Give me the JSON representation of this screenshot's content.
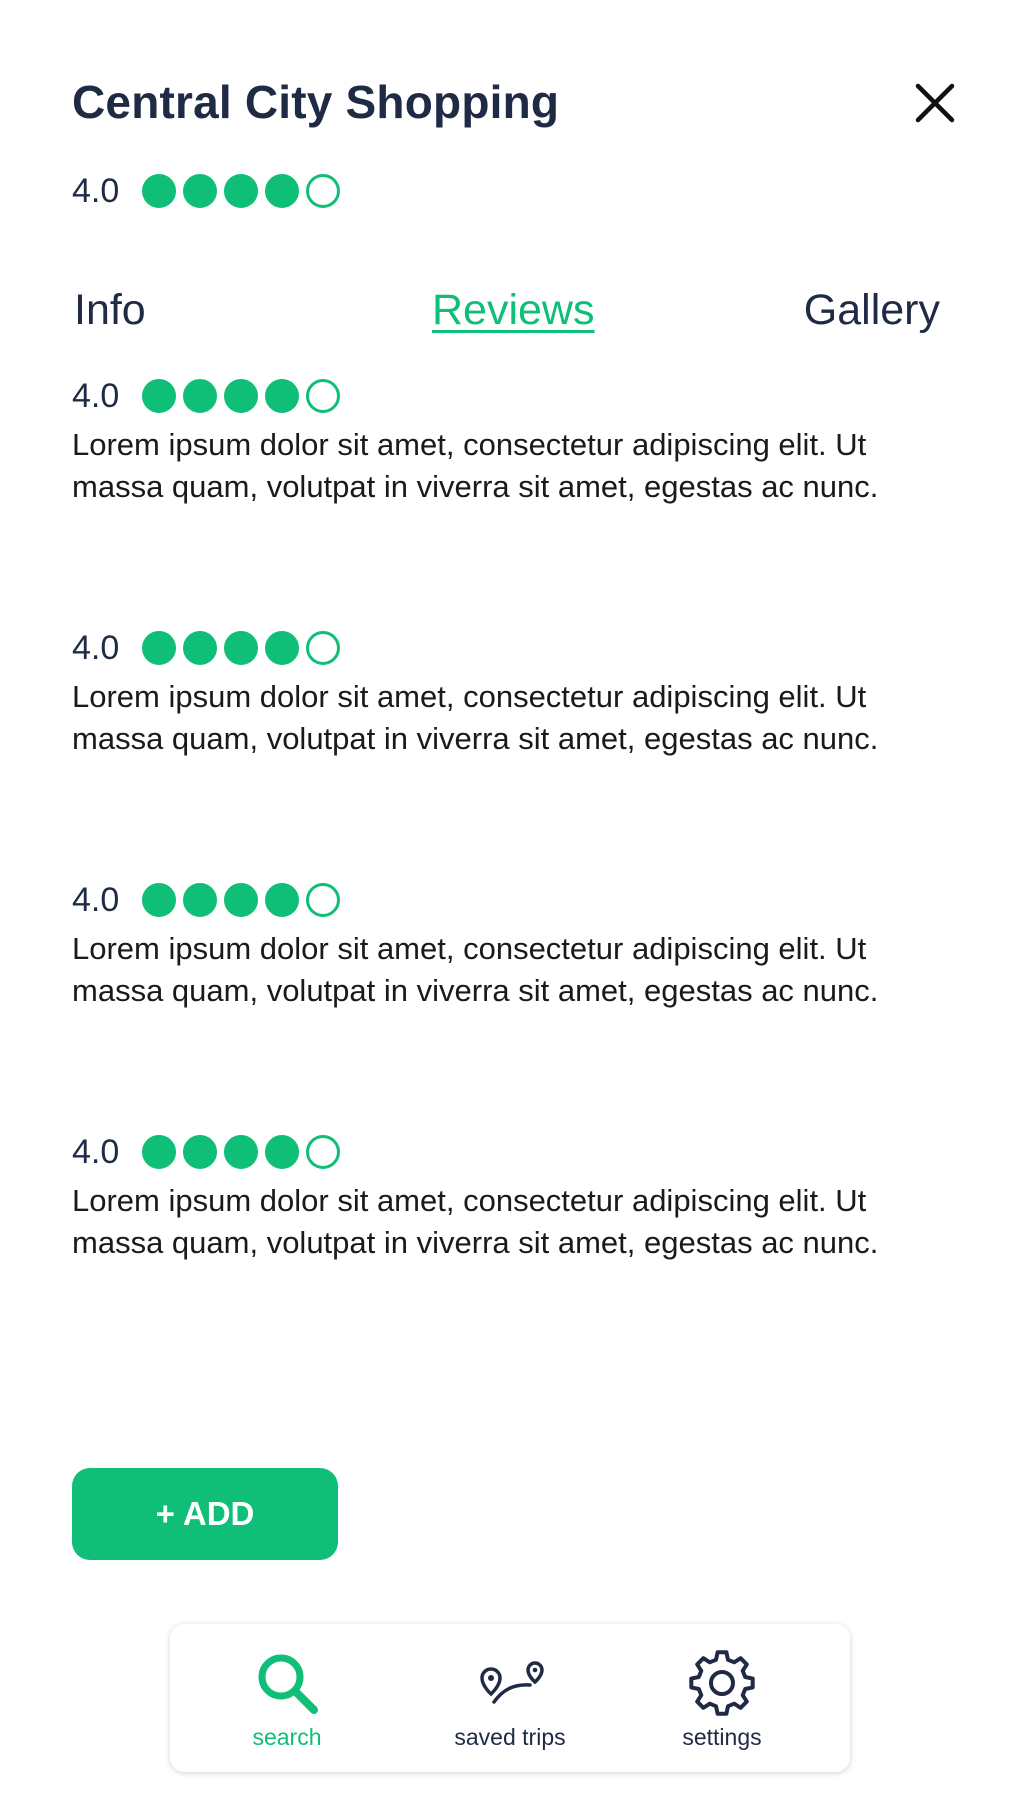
{
  "header": {
    "title": "Central City Shopping",
    "rating_value": "4.0",
    "rating_stars": 4,
    "rating_max": 5
  },
  "tabs": [
    {
      "label": "Info",
      "active": false
    },
    {
      "label": "Reviews",
      "active": true
    },
    {
      "label": "Gallery",
      "active": false
    }
  ],
  "reviews": [
    {
      "rating": "4.0",
      "stars": 4,
      "text": "Lorem ipsum dolor sit amet, consectetur adipiscing elit. Ut massa quam, volutpat in viverra sit amet, egestas ac nunc."
    },
    {
      "rating": "4.0",
      "stars": 4,
      "text": "Lorem ipsum dolor sit amet, consectetur adipiscing elit. Ut massa quam, volutpat in viverra sit amet, egestas ac nunc."
    },
    {
      "rating": "4.0",
      "stars": 4,
      "text": "Lorem ipsum dolor sit amet, consectetur adipiscing elit. Ut massa quam, volutpat in viverra sit amet, egestas ac nunc."
    },
    {
      "rating": "4.0",
      "stars": 4,
      "text": "Lorem ipsum dolor sit amet, consectetur adipiscing elit. Ut massa quam, volutpat in viverra sit amet, egestas ac nunc."
    }
  ],
  "add_button": {
    "label": "+ ADD"
  },
  "bottom_nav": [
    {
      "label": "search",
      "icon": "search-icon",
      "active": true
    },
    {
      "label": "saved trips",
      "icon": "route-icon",
      "active": false
    },
    {
      "label": "settings",
      "icon": "gear-icon",
      "active": false
    }
  ],
  "colors": {
    "accent": "#0fbf77",
    "text_dark": "#1f2a44"
  }
}
